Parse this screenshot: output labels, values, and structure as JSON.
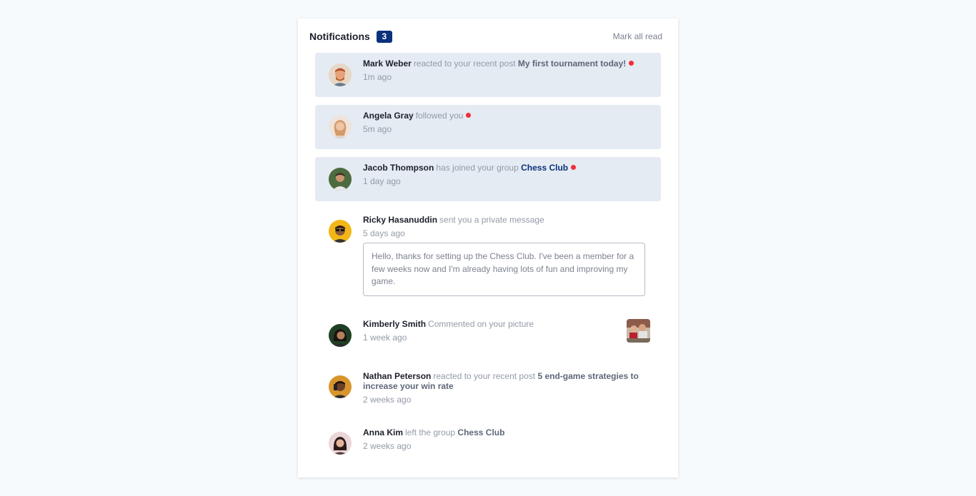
{
  "header": {
    "title": "Notifications",
    "unread_count": "3",
    "mark_all_label": "Mark all read"
  },
  "notifications": [
    {
      "name": "Mark Weber",
      "action": "reacted to your recent post",
      "target": "My first tournament today!",
      "time": "1m ago",
      "unread": true
    },
    {
      "name": "Angela Gray",
      "action": "followed you",
      "time": "5m ago",
      "unread": true
    },
    {
      "name": "Jacob Thompson",
      "action": "has joined your group",
      "target": "Chess Club",
      "time": "1 day ago",
      "unread": true
    },
    {
      "name": "Ricky Hasanuddin",
      "action": "sent you a private message",
      "time": "5 days ago",
      "message": "Hello, thanks for setting up the Chess Club. I've been a member for a few weeks now and I'm already having lots of fun and improving my game.",
      "unread": false
    },
    {
      "name": "Kimberly Smith",
      "action": "Commented on your picture",
      "time": "1 week ago",
      "unread": false
    },
    {
      "name": "Nathan Peterson",
      "action": "reacted to your recent post",
      "target": "5 end-game strategies to increase your win rate",
      "time": "2 weeks ago",
      "unread": false
    },
    {
      "name": "Anna Kim",
      "action": "left the group",
      "target": "Chess Club",
      "time": "2 weeks ago",
      "unread": false
    }
  ],
  "colors": {
    "background": "#f7fafd",
    "unread_bg": "#e4ebf2",
    "badge": "#0a317b",
    "dot": "#f52d38"
  }
}
